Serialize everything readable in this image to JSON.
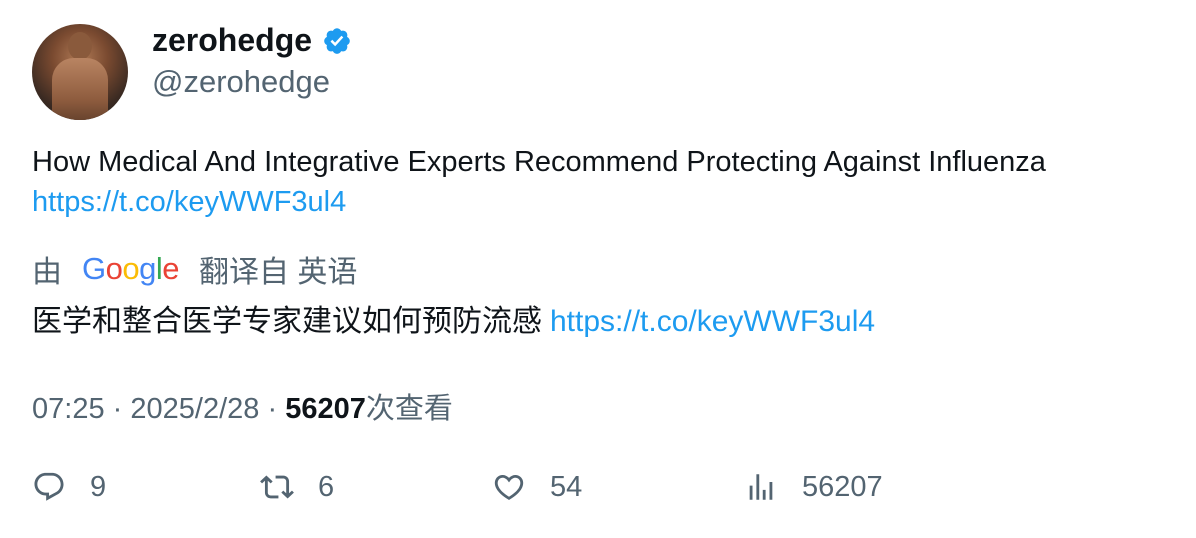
{
  "author": {
    "display_name": "zerohedge",
    "handle": "@zerohedge",
    "verified": true,
    "verified_color": "#1d9bf0"
  },
  "tweet": {
    "text": "How Medical And Integrative Experts Recommend Protecting Against Influenza",
    "link": "https://t.co/keyWWF3ul4"
  },
  "translation": {
    "prefix": "由",
    "provider": "Google",
    "suffix": "翻译自 英语",
    "text": "医学和整合医学专家建议如何预防流感",
    "link": "https://t.co/keyWWF3ul4"
  },
  "meta": {
    "time": "07:25",
    "separator": "·",
    "date": "2025/2/28",
    "views_count": "56207",
    "views_label": "次查看"
  },
  "actions": {
    "replies": "9",
    "retweets": "6",
    "likes": "54",
    "views": "56207"
  },
  "colors": {
    "link": "#1d9bf0",
    "muted_text": "#536471",
    "text": "#0f1419"
  }
}
